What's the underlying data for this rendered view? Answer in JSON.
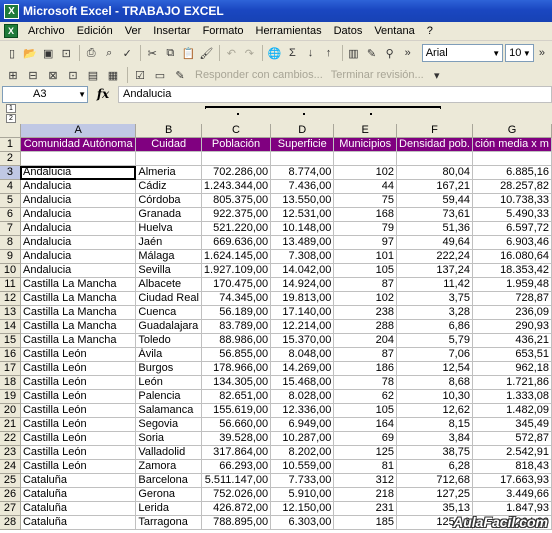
{
  "window": {
    "title": "Microsoft Excel - TRABAJO EXCEL"
  },
  "menu": [
    "Archivo",
    "Edición",
    "Ver",
    "Insertar",
    "Formato",
    "Herramientas",
    "Datos",
    "Ventana",
    "?"
  ],
  "toolbar": {
    "font_name": "Arial",
    "font_size": "10",
    "reply_with_changes": "Responder con cambios...",
    "end_review": "Terminar revisión..."
  },
  "formula_bar": {
    "name_box": "A3",
    "fx": "fx",
    "content": "Andalucia"
  },
  "outline": {
    "levels": [
      "1",
      "2"
    ]
  },
  "columns": [
    "A",
    "B",
    "C",
    "D",
    "E",
    "F",
    "G"
  ],
  "header_row": [
    "Comunidad Autónoma",
    "Cuidad",
    "Población",
    "Superficie",
    "Municipios",
    "Densidad pob.",
    "ción media x m"
  ],
  "rows": [
    [
      "Andalucia",
      "Almeria",
      "702.286,00",
      "8.774,00",
      "102",
      "80,04",
      "6.885,16"
    ],
    [
      "Andalucia",
      "Cádiz",
      "1.243.344,00",
      "7.436,00",
      "44",
      "167,21",
      "28.257,82"
    ],
    [
      "Andalucia",
      "Córdoba",
      "805.375,00",
      "13.550,00",
      "75",
      "59,44",
      "10.738,33"
    ],
    [
      "Andalucia",
      "Granada",
      "922.375,00",
      "12.531,00",
      "168",
      "73,61",
      "5.490,33"
    ],
    [
      "Andalucia",
      "Huelva",
      "521.220,00",
      "10.148,00",
      "79",
      "51,36",
      "6.597,72"
    ],
    [
      "Andalucia",
      "Jaén",
      "669.636,00",
      "13.489,00",
      "97",
      "49,64",
      "6.903,46"
    ],
    [
      "Andalucia",
      "Málaga",
      "1.624.145,00",
      "7.308,00",
      "101",
      "222,24",
      "16.080,64"
    ],
    [
      "Andalucia",
      "Sevilla",
      "1.927.109,00",
      "14.042,00",
      "105",
      "137,24",
      "18.353,42"
    ],
    [
      "Castilla La Mancha",
      "Albacete",
      "170.475,00",
      "14.924,00",
      "87",
      "11,42",
      "1.959,48"
    ],
    [
      "Castilla La Mancha",
      "Ciudad Real",
      "74.345,00",
      "19.813,00",
      "102",
      "3,75",
      "728,87"
    ],
    [
      "Castilla La Mancha",
      "Cuenca",
      "56.189,00",
      "17.140,00",
      "238",
      "3,28",
      "236,09"
    ],
    [
      "Castilla La Mancha",
      "Guadalajara",
      "83.789,00",
      "12.214,00",
      "288",
      "6,86",
      "290,93"
    ],
    [
      "Castilla La Mancha",
      "Toledo",
      "88.986,00",
      "15.370,00",
      "204",
      "5,79",
      "436,21"
    ],
    [
      "Castilla León",
      "Ávila",
      "56.855,00",
      "8.048,00",
      "87",
      "7,06",
      "653,51"
    ],
    [
      "Castilla León",
      "Burgos",
      "178.966,00",
      "14.269,00",
      "186",
      "12,54",
      "962,18"
    ],
    [
      "Castilla León",
      "León",
      "134.305,00",
      "15.468,00",
      "78",
      "8,68",
      "1.721,86"
    ],
    [
      "Castilla León",
      "Palencia",
      "82.651,00",
      "8.028,00",
      "62",
      "10,30",
      "1.333,08"
    ],
    [
      "Castilla León",
      "Salamanca",
      "155.619,00",
      "12.336,00",
      "105",
      "12,62",
      "1.482,09"
    ],
    [
      "Castilla León",
      "Segovia",
      "56.660,00",
      "6.949,00",
      "164",
      "8,15",
      "345,49"
    ],
    [
      "Castilla León",
      "Soria",
      "39.528,00",
      "10.287,00",
      "69",
      "3,84",
      "572,87"
    ],
    [
      "Castilla León",
      "Valladolid",
      "317.864,00",
      "8.202,00",
      "125",
      "38,75",
      "2.542,91"
    ],
    [
      "Castilla León",
      "Zamora",
      "66.293,00",
      "10.559,00",
      "81",
      "6,28",
      "818,43"
    ],
    [
      "Cataluña",
      "Barcelona",
      "5.511.147,00",
      "7.733,00",
      "312",
      "712,68",
      "17.663,93"
    ],
    [
      "Cataluña",
      "Gerona",
      "752.026,00",
      "5.910,00",
      "218",
      "127,25",
      "3.449,66"
    ],
    [
      "Cataluña",
      "Lerida",
      "426.872,00",
      "12.150,00",
      "231",
      "35,13",
      "1.847,93"
    ],
    [
      "Cataluña",
      "Tarragona",
      "788.895,00",
      "6.303,00",
      "185",
      "125,16",
      "4.264,30"
    ]
  ],
  "watermark": "AulaFacil.com",
  "colors": {
    "header_fill": "#800080",
    "header_text": "#ffffff",
    "titlebar": "#1a47c1"
  }
}
